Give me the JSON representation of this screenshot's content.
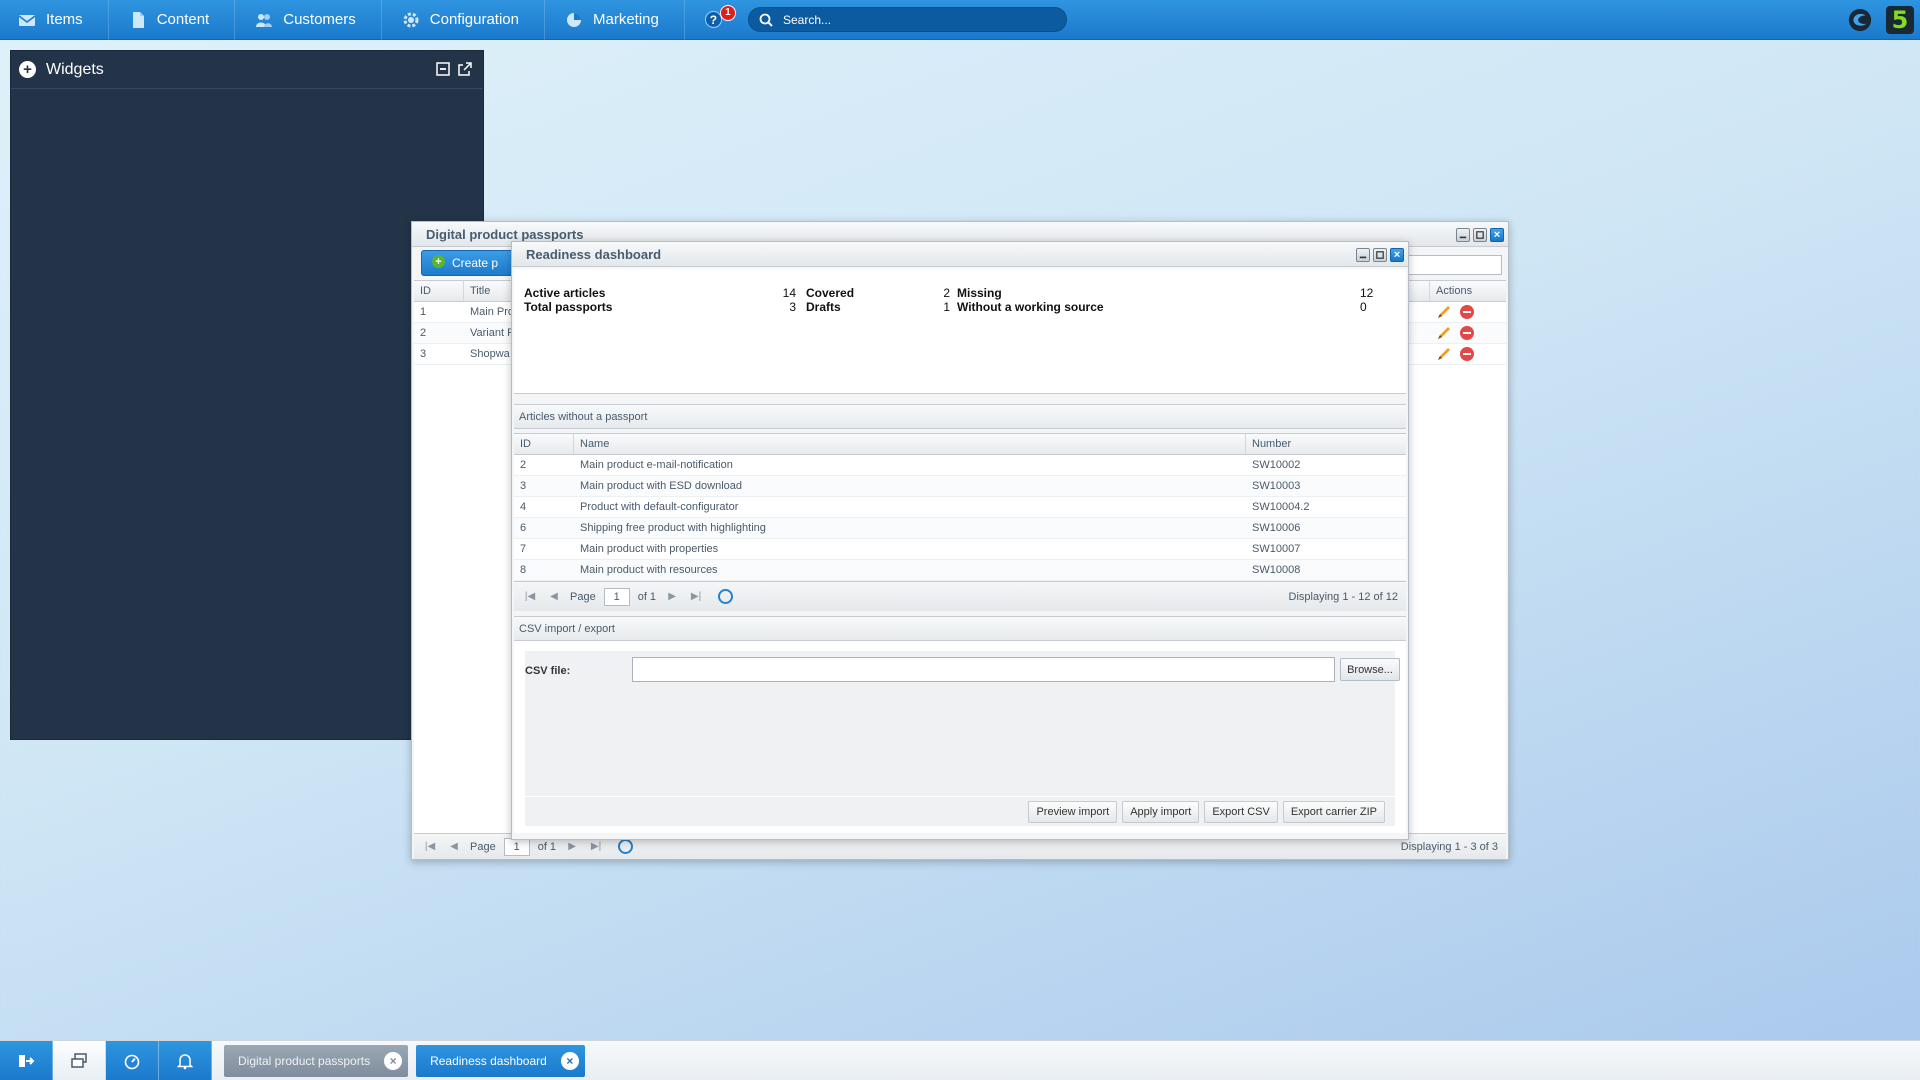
{
  "topbar": {
    "menu": [
      {
        "label": "Items",
        "icon": "envelope-icon"
      },
      {
        "label": "Content",
        "icon": "document-icon"
      },
      {
        "label": "Customers",
        "icon": "users-icon"
      },
      {
        "label": "Configuration",
        "icon": "gear-icon"
      },
      {
        "label": "Marketing",
        "icon": "pie-chart-icon"
      }
    ],
    "help_glyph": "?",
    "notification_count": "1",
    "search_placeholder": "Search...",
    "logo_text": "5"
  },
  "widgets": {
    "title": "Widgets"
  },
  "dpp_window": {
    "title": "Digital product passports",
    "create_label": "Create p",
    "columns": [
      "ID",
      "Title",
      "Actions"
    ],
    "rows": [
      {
        "id": "1",
        "title": "Main Pro"
      },
      {
        "id": "2",
        "title": "Variant P"
      },
      {
        "id": "3",
        "title": "Shopwa"
      }
    ],
    "pager": {
      "page_label": "Page",
      "page": "1",
      "of": "of 1",
      "displaying": "Displaying 1 - 3 of 3"
    }
  },
  "ready_window": {
    "title": "Readiness dashboard",
    "stats": {
      "active_articles_label": "Active articles",
      "active_articles": "14",
      "total_passports_label": "Total passports",
      "total_passports": "3",
      "covered_label": "Covered",
      "covered": "2",
      "drafts_label": "Drafts",
      "drafts": "1",
      "missing_label": "Missing",
      "missing": "12",
      "without_source_label": "Without a working source",
      "without_source": "0"
    },
    "articles": {
      "title": "Articles without a passport",
      "columns": [
        "ID",
        "Name",
        "Number"
      ],
      "rows": [
        {
          "id": "2",
          "name": "Main product e-mail-notification",
          "number": "SW10002"
        },
        {
          "id": "3",
          "name": "Main product with ESD download",
          "number": "SW10003"
        },
        {
          "id": "4",
          "name": "Product with default-configurator",
          "number": "SW10004.2"
        },
        {
          "id": "6",
          "name": "Shipping free product with highlighting",
          "number": "SW10006"
        },
        {
          "id": "7",
          "name": "Main product with properties",
          "number": "SW10007"
        },
        {
          "id": "8",
          "name": "Main product with resources",
          "number": "SW10008"
        }
      ],
      "pager": {
        "page_label": "Page",
        "page": "1",
        "of": "of 1",
        "displaying": "Displaying 1 - 12 of 12"
      }
    },
    "csv": {
      "title": "CSV import / export",
      "file_label": "CSV file:",
      "browse_label": "Browse...",
      "buttons": [
        "Preview import",
        "Apply import",
        "Export CSV",
        "Export carrier ZIP"
      ]
    }
  },
  "taskbar": {
    "tasks": [
      {
        "label": "Digital product passports",
        "state": "inactive"
      },
      {
        "label": "Readiness dashboard",
        "state": "active"
      }
    ],
    "close_glyph": "×"
  },
  "colors": {
    "accent": "#1b79cc",
    "dark_panel": "#233449",
    "delete": "#e34848",
    "logo_green": "#7fdc1f"
  }
}
